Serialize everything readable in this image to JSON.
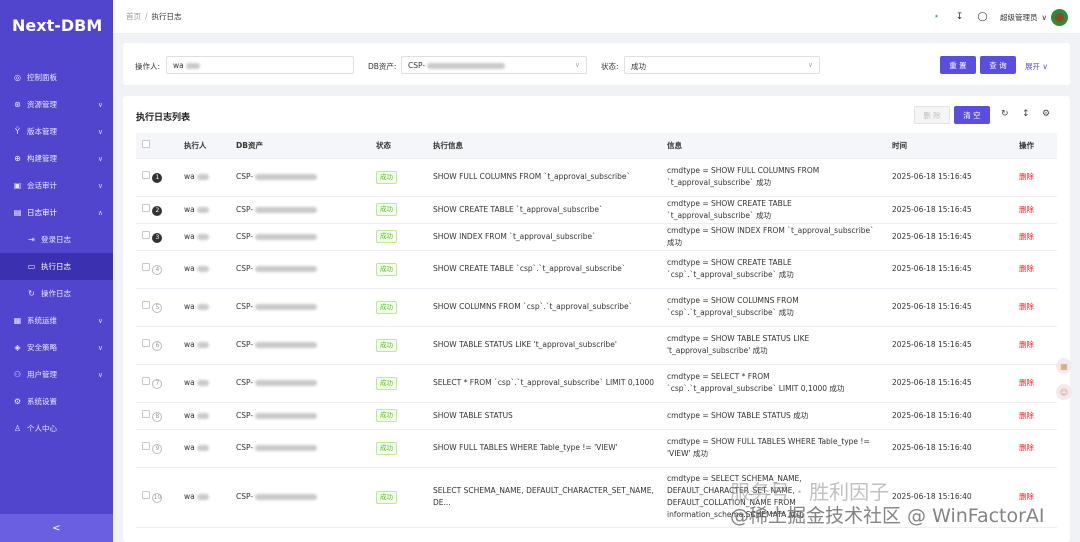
{
  "app": {
    "logo": "Next-DBM"
  },
  "sidebar": {
    "items": [
      {
        "label": "控制面板",
        "icon": "dashboard-icon",
        "has_children": false
      },
      {
        "label": "资源管理",
        "icon": "resource-icon",
        "has_children": true
      },
      {
        "label": "版本管理",
        "icon": "version-icon",
        "has_children": true
      },
      {
        "label": "构建管理",
        "icon": "build-icon",
        "has_children": true
      },
      {
        "label": "会话审计",
        "icon": "session-audit-icon",
        "has_children": true
      },
      {
        "label": "日志审计",
        "icon": "log-audit-icon",
        "has_children": true,
        "open": true,
        "children": [
          {
            "label": "登录日志",
            "icon": "login-log-icon"
          },
          {
            "label": "执行日志",
            "icon": "exec-log-icon",
            "active": true
          },
          {
            "label": "操作日志",
            "icon": "operation-log-icon"
          }
        ]
      },
      {
        "label": "系统运维",
        "icon": "ops-icon",
        "has_children": true
      },
      {
        "label": "安全策略",
        "icon": "security-icon",
        "has_children": true
      },
      {
        "label": "用户管理",
        "icon": "user-icon",
        "has_children": true
      },
      {
        "label": "系统设置",
        "icon": "settings-icon",
        "has_children": false
      },
      {
        "label": "个人中心",
        "icon": "profile-icon",
        "has_children": false
      }
    ],
    "collapse_glyph": "<"
  },
  "header": {
    "breadcrumb": [
      "首页",
      "/",
      "执行日志"
    ],
    "user_name": "超级管理员",
    "icons": [
      "network-icon",
      "download-icon",
      "globe-icon"
    ]
  },
  "filter": {
    "operator_label": "操作人:",
    "operator_value": "wa",
    "db_label": "DB资产:",
    "db_value": "CSP-",
    "status_label": "状态:",
    "status_value": "成功",
    "reset_label": "重 置",
    "search_label": "查 询",
    "expand_label": "展开"
  },
  "table_card": {
    "title": "执行日志列表",
    "delete_label": "删 除",
    "clear_label": "清 空",
    "columns": [
      "",
      "执行人",
      "DB资产",
      "状态",
      "执行信息",
      "信息",
      "时间",
      "操作"
    ],
    "rows": [
      {
        "n": "1",
        "user": "wa",
        "db": "CSP-",
        "status": "成功",
        "exec": "SHOW FULL COLUMNS FROM `t_approval_subscribe`",
        "info": "cmdtype = SHOW FULL COLUMNS FROM `t_approval_subscribe` 成功",
        "time": "2025-06-18 15:16:45",
        "op": "删除",
        "dark": true
      },
      {
        "n": "2",
        "user": "wa",
        "db": "CSP-",
        "status": "成功",
        "exec": "SHOW CREATE TABLE `t_approval_subscribe`",
        "info": "cmdtype = SHOW CREATE TABLE `t_approval_subscribe` 成功",
        "time": "2025-06-18 15:16:45",
        "op": "删除",
        "dark": true
      },
      {
        "n": "3",
        "user": "wa",
        "db": "CSP-",
        "status": "成功",
        "exec": "SHOW INDEX FROM `t_approval_subscribe`",
        "info": "cmdtype = SHOW INDEX FROM `t_approval_subscribe` 成功",
        "time": "2025-06-18 15:16:45",
        "op": "删除",
        "dark": true
      },
      {
        "n": "4",
        "user": "wa",
        "db": "CSP-",
        "status": "成功",
        "exec": "SHOW CREATE TABLE `csp`.`t_approval_subscribe`",
        "info": "cmdtype = SHOW CREATE TABLE `csp`.`t_approval_subscribe` 成功",
        "time": "2025-06-18 15:16:45",
        "op": "删除",
        "dark": false
      },
      {
        "n": "5",
        "user": "wa",
        "db": "CSP-",
        "status": "成功",
        "exec": "SHOW COLUMNS FROM `csp`.`t_approval_subscribe`",
        "info": "cmdtype = SHOW COLUMNS FROM `csp`.`t_approval_subscribe` 成功",
        "time": "2025-06-18 15:16:45",
        "op": "删除",
        "dark": false
      },
      {
        "n": "6",
        "user": "wa",
        "db": "CSP-",
        "status": "成功",
        "exec": "SHOW TABLE STATUS LIKE 't_approval_subscribe'",
        "info": "cmdtype = SHOW TABLE STATUS LIKE 't_approval_subscribe' 成功",
        "time": "2025-06-18 15:16:45",
        "op": "删除",
        "dark": false
      },
      {
        "n": "7",
        "user": "wa",
        "db": "CSP-",
        "status": "成功",
        "exec": "SELECT * FROM `csp`.`t_approval_subscribe` LIMIT 0,1000",
        "info": "cmdtype = SELECT * FROM `csp`.`t_approval_subscribe` LIMIT 0,1000 成功",
        "time": "2025-06-18 15:16:45",
        "op": "删除",
        "dark": false
      },
      {
        "n": "8",
        "user": "wa",
        "db": "CSP-",
        "status": "成功",
        "exec": "SHOW TABLE STATUS",
        "info": "cmdtype = SHOW TABLE STATUS 成功",
        "time": "2025-06-18 15:16:40",
        "op": "删除",
        "dark": false
      },
      {
        "n": "9",
        "user": "wa",
        "db": "CSP-",
        "status": "成功",
        "exec": "SHOW FULL TABLES WHERE Table_type != 'VIEW'",
        "info": "cmdtype = SHOW FULL TABLES WHERE Table_type != 'VIEW' 成功",
        "time": "2025-06-18 15:16:40",
        "op": "删除",
        "dark": false
      },
      {
        "n": "10",
        "user": "wa",
        "db": "CSP-",
        "status": "成功",
        "exec": "SELECT SCHEMA_NAME, DEFAULT_CHARACTER_SET_NAME, DE...",
        "info": "cmdtype = SELECT SCHEMA_NAME, DEFAULT_CHARACTER_SET_NAME, DEFAULT_COLLATION_NAME FROM information_schema.SCHEMATA 成功",
        "time": "2025-06-18 15:16:40",
        "op": "删除",
        "dark": false
      }
    ]
  },
  "watermark": {
    "line1": "服务号 · 胜利因子",
    "line2": "@稀土掘金技术社区 @ WinFactorAI"
  },
  "colors": {
    "sidebar": "#5145cd",
    "primary": "#5a4ee0",
    "danger": "#f5222d",
    "success": "#52c41a"
  }
}
